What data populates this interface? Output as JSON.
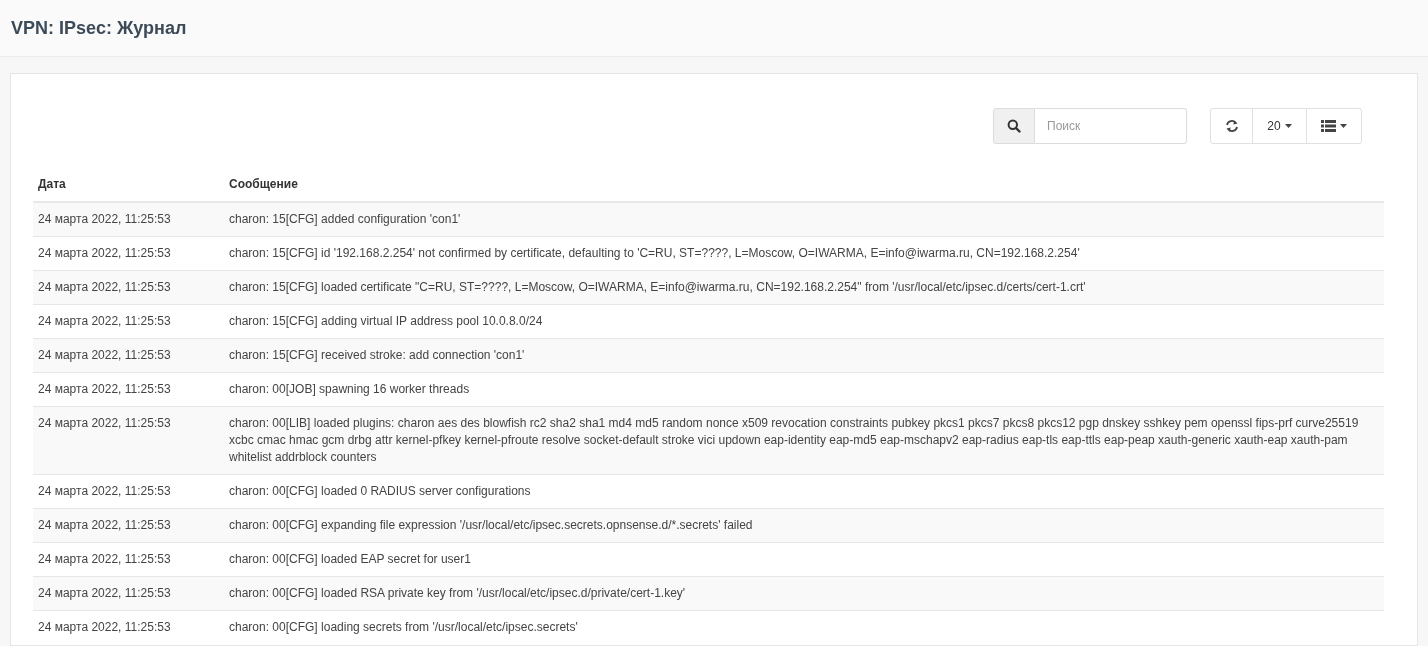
{
  "page_title": "VPN: IPsec: Журнал",
  "toolbar": {
    "search": {
      "placeholder": "Поиск"
    },
    "page_size": "20"
  },
  "table": {
    "columns": [
      "Дата",
      "Сообщение"
    ],
    "rows": [
      {
        "date": "24 марта 2022, 11:25:53",
        "message": "charon: 15[CFG] added configuration 'con1'"
      },
      {
        "date": "24 марта 2022, 11:25:53",
        "message": "charon: 15[CFG] id '192.168.2.254' not confirmed by certificate, defaulting to 'C=RU, ST=????, L=Moscow, O=IWARMA, E=info@iwarma.ru, CN=192.168.2.254'"
      },
      {
        "date": "24 марта 2022, 11:25:53",
        "message": "charon: 15[CFG] loaded certificate \"C=RU, ST=????, L=Moscow, O=IWARMA, E=info@iwarma.ru, CN=192.168.2.254\" from '/usr/local/etc/ipsec.d/certs/cert-1.crt'"
      },
      {
        "date": "24 марта 2022, 11:25:53",
        "message": "charon: 15[CFG] adding virtual IP address pool 10.0.8.0/24"
      },
      {
        "date": "24 марта 2022, 11:25:53",
        "message": "charon: 15[CFG] received stroke: add connection 'con1'"
      },
      {
        "date": "24 марта 2022, 11:25:53",
        "message": "charon: 00[JOB] spawning 16 worker threads"
      },
      {
        "date": "24 марта 2022, 11:25:53",
        "message": "charon: 00[LIB] loaded plugins: charon aes des blowfish rc2 sha2 sha1 md4 md5 random nonce x509 revocation constraints pubkey pkcs1 pkcs7 pkcs8 pkcs12 pgp dnskey sshkey pem openssl fips-prf curve25519 xcbc cmac hmac gcm drbg attr kernel-pfkey kernel-pfroute resolve socket-default stroke vici updown eap-identity eap-md5 eap-mschapv2 eap-radius eap-tls eap-ttls eap-peap xauth-generic xauth-eap xauth-pam whitelist addrblock counters"
      },
      {
        "date": "24 марта 2022, 11:25:53",
        "message": "charon: 00[CFG] loaded 0 RADIUS server configurations"
      },
      {
        "date": "24 марта 2022, 11:25:53",
        "message": "charon: 00[CFG] expanding file expression '/usr/local/etc/ipsec.secrets.opnsense.d/*.secrets' failed"
      },
      {
        "date": "24 марта 2022, 11:25:53",
        "message": "charon: 00[CFG] loaded EAP secret for user1"
      },
      {
        "date": "24 марта 2022, 11:25:53",
        "message": "charon: 00[CFG] loaded RSA private key from '/usr/local/etc/ipsec.d/private/cert-1.key'"
      },
      {
        "date": "24 марта 2022, 11:25:53",
        "message": "charon: 00[CFG] loading secrets from '/usr/local/etc/ipsec.secrets'"
      }
    ]
  }
}
